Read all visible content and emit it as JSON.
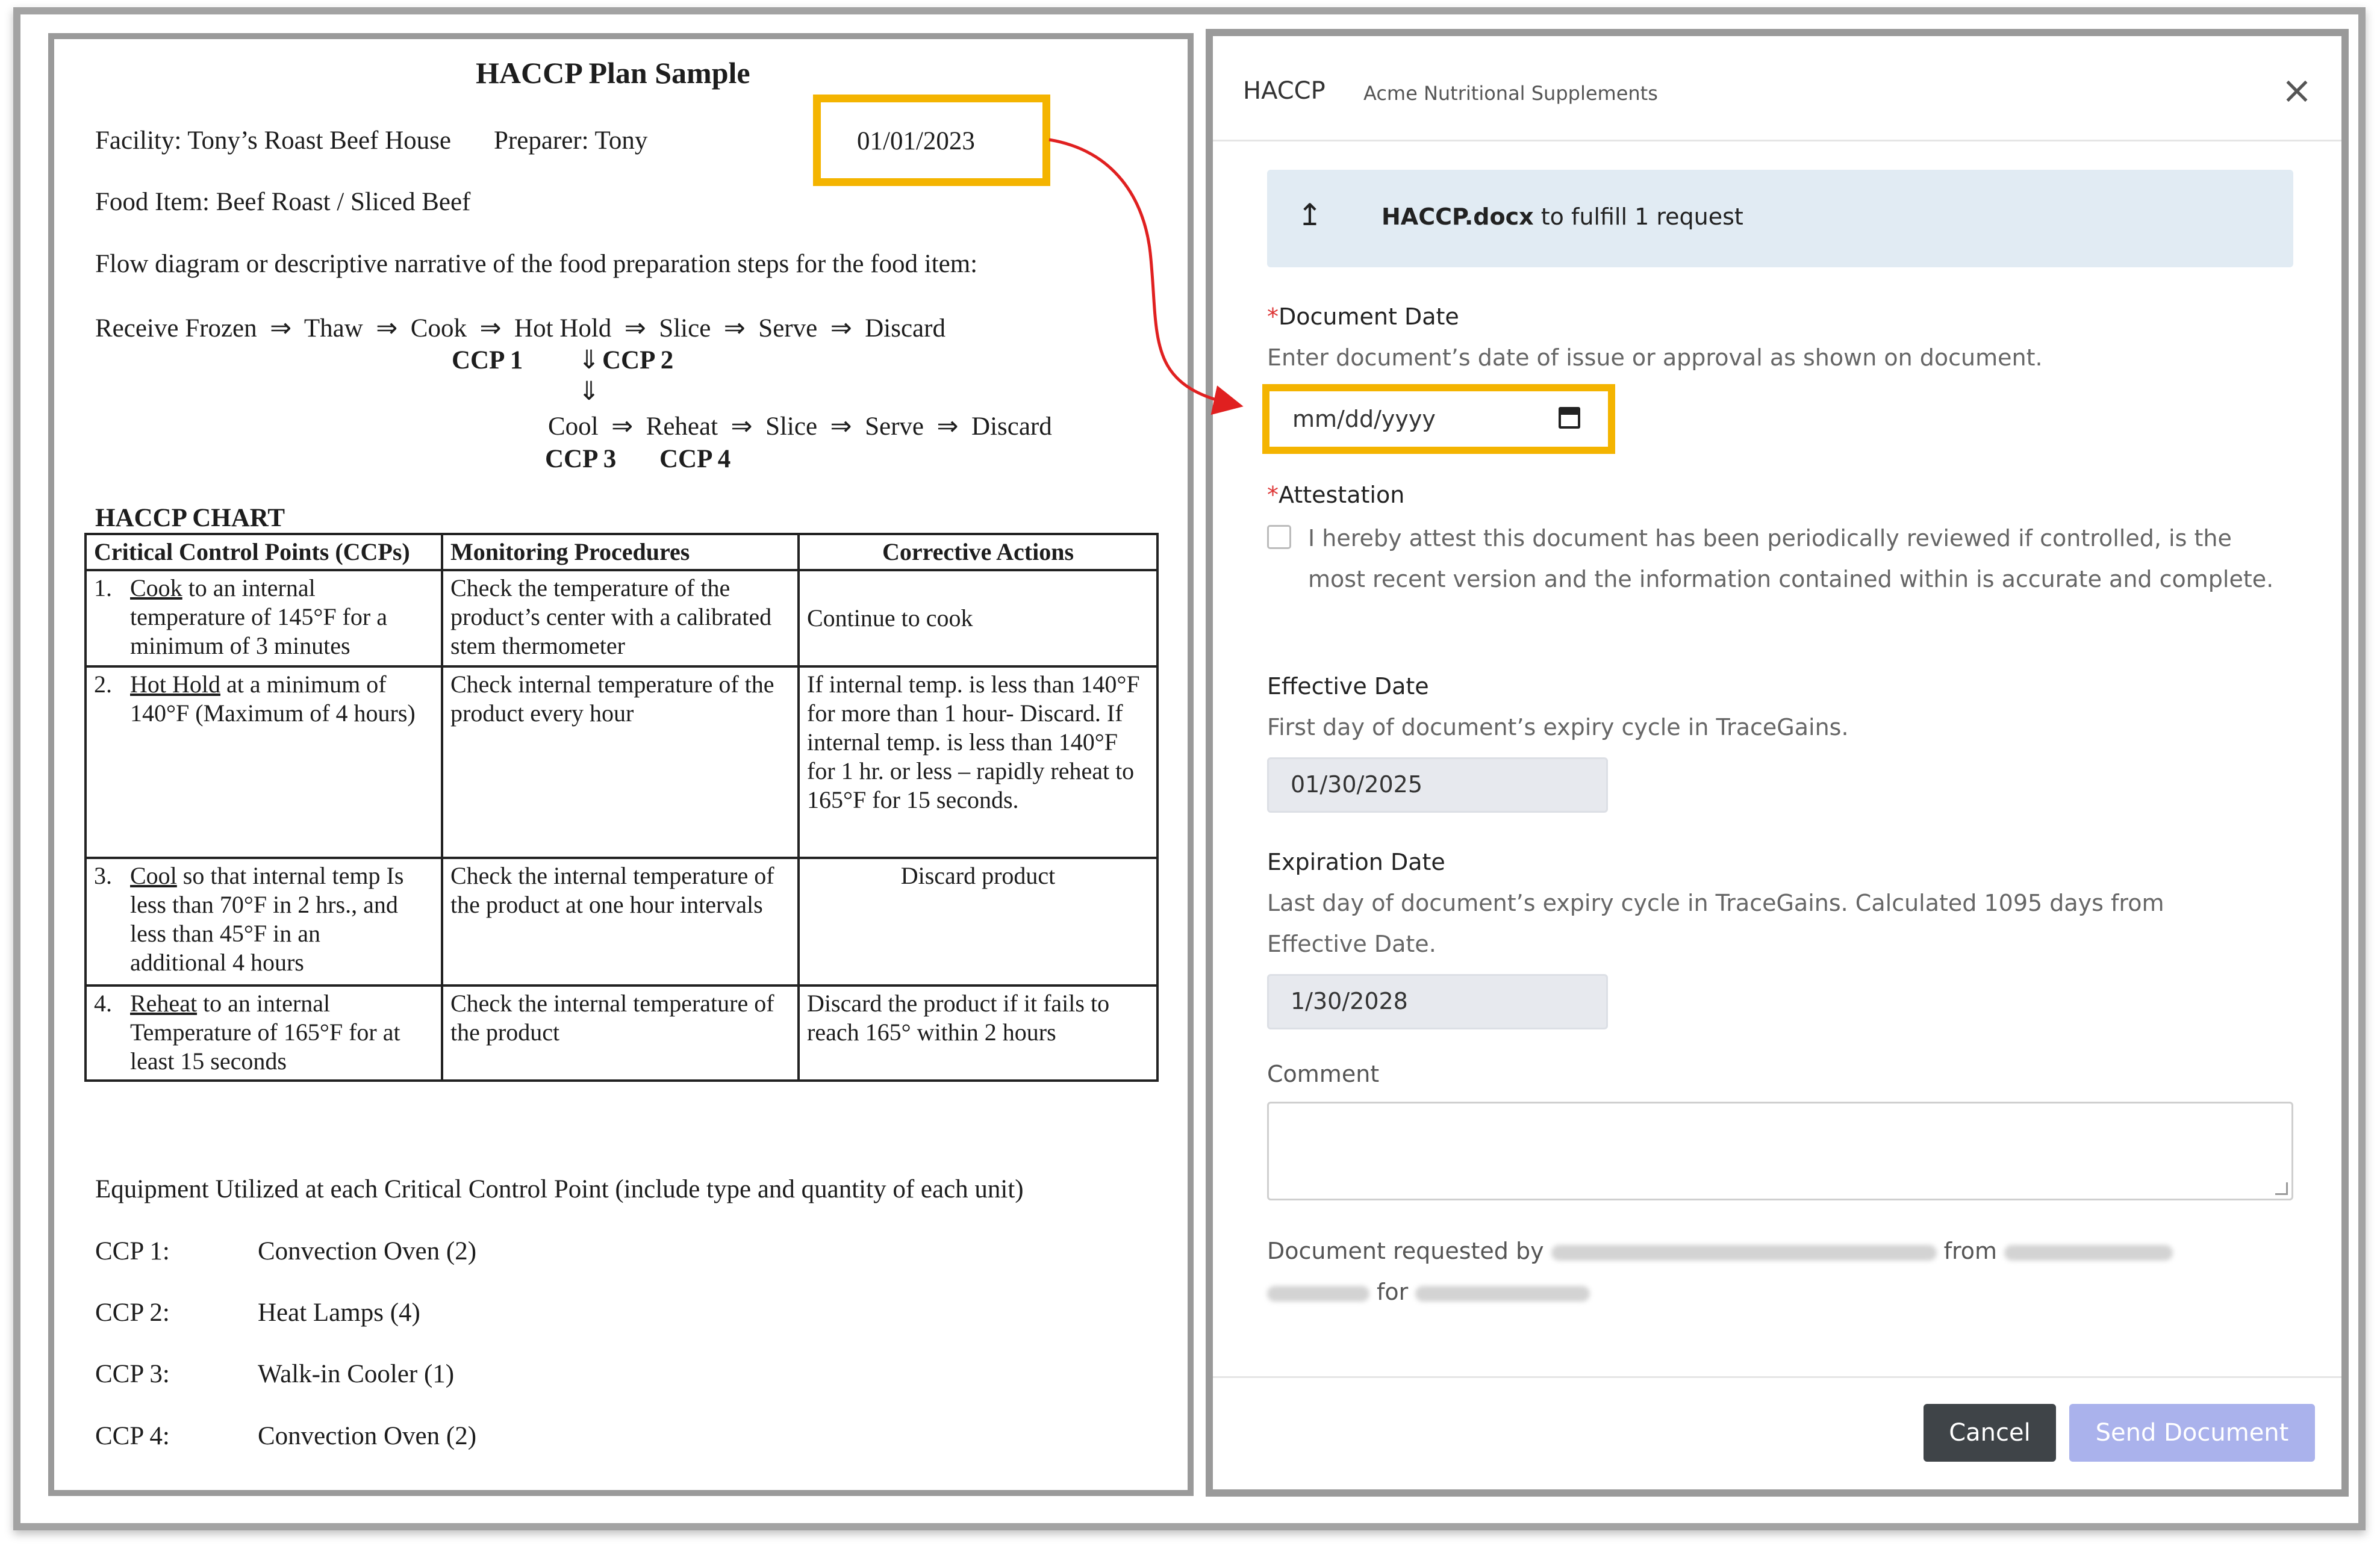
{
  "document": {
    "title": "HACCP Plan Sample",
    "facility": "Facility: Tony’s Roast Beef House",
    "preparer": "Preparer: Tony",
    "date": "01/01/2023",
    "food_item": "Food Item: Beef Roast / Sliced Beef",
    "flow_intro": "Flow diagram or descriptive narrative of the food preparation steps for the food item:",
    "flow_row1": "Receive Frozen  ⇒  Thaw  ⇒  Cook  ⇒  Hot Hold  ⇒  Slice  ⇒  Serve  ⇒  Discard",
    "ccp1": "CCP 1",
    "ccp2_arrow": "⇓",
    "ccp2": "CCP 2",
    "down_arrow": "⇓",
    "flow_row2": "Cool  ⇒  Reheat  ⇒  Slice  ⇒  Serve  ⇒  Discard",
    "ccp3": "CCP 3",
    "ccp4": "CCP 4",
    "chart_title": "HACCP CHART",
    "table_headers": [
      "Critical Control Points (CCPs)",
      "Monitoring Procedures",
      "Corrective Actions"
    ],
    "rows": [
      {
        "num": "1.",
        "key": "Cook",
        "rest": " to an internal temperature of 145°F for a minimum of 3 minutes",
        "monitor": "Check the temperature of the product’s center with a calibrated stem thermometer",
        "action": "Continue to cook"
      },
      {
        "num": "2.",
        "key": "Hot Hold",
        "rest": " at a minimum of 140°F (Maximum of 4 hours)",
        "monitor": "Check internal temperature of the product every hour",
        "action": "If internal temp. is less than 140°F for more than 1 hour- Discard.  If internal temp. is less than 140°F for 1 hr. or less – rapidly reheat to 165°F for 15 seconds."
      },
      {
        "num": "3.",
        "key": "Cool",
        "rest": " so that internal temp Is less than 70°F in 2 hrs., and less than 45°F in an additional 4 hours",
        "monitor": "Check the internal temperature of the product at one hour intervals",
        "action": "Discard product"
      },
      {
        "num": "4.",
        "key": "Reheat",
        "rest": " to an internal Temperature of 165°F for at least 15 seconds",
        "monitor": "Check the internal temperature of the product",
        "action": "Discard the product if it fails to reach 165° within 2 hours"
      }
    ],
    "equipment_intro": "Equipment Utilized at each Critical Control Point (include type and quantity of each unit)",
    "equipment": [
      {
        "ccp": "CCP 1:",
        "item": "Convection Oven (2)"
      },
      {
        "ccp": "CCP 2:",
        "item": "Heat Lamps (4)"
      },
      {
        "ccp": "CCP 3:",
        "item": "Walk-in Cooler (1)"
      },
      {
        "ccp": "CCP 4:",
        "item": "Convection Oven (2)"
      }
    ]
  },
  "form": {
    "title": "HACCP",
    "subtitle": "Acme Nutritional Supplements",
    "close_icon": "×",
    "upload_icon": "↥",
    "upload_file": "HACCP.docx",
    "upload_rest": " to fulfill 1 request",
    "required_mark": "*",
    "document_date_label": "Document Date",
    "document_date_help": "Enter document’s date of issue or approval as shown on document.",
    "document_date_placeholder": "mm/dd/yyyy",
    "attestation_label": "Attestation",
    "attestation_text": "I hereby attest this document has been periodically reviewed if controlled, is the most recent version and the information contained within is accurate and complete.",
    "effective_label": "Effective Date",
    "effective_help": "First day of document’s expiry cycle in TraceGains.",
    "effective_value": "01/30/2025",
    "expiration_label": "Expiration Date",
    "expiration_help_1": "Last day of document’s expiry cycle in TraceGains. Calculated 1095 days from",
    "expiration_help_2": "Effective Date.",
    "expiration_value": "1/30/2028",
    "comment_label": "Comment",
    "requested_by": "Document requested by",
    "from": "from",
    "for": "for",
    "cancel_label": "Cancel",
    "send_label": "Send Document"
  },
  "colors": {
    "highlight": "#f4b400",
    "arrow": "#e02020",
    "upload_bg": "#e1ebf3",
    "send_button": "#aab2ec",
    "cancel_button": "#3f4448"
  }
}
